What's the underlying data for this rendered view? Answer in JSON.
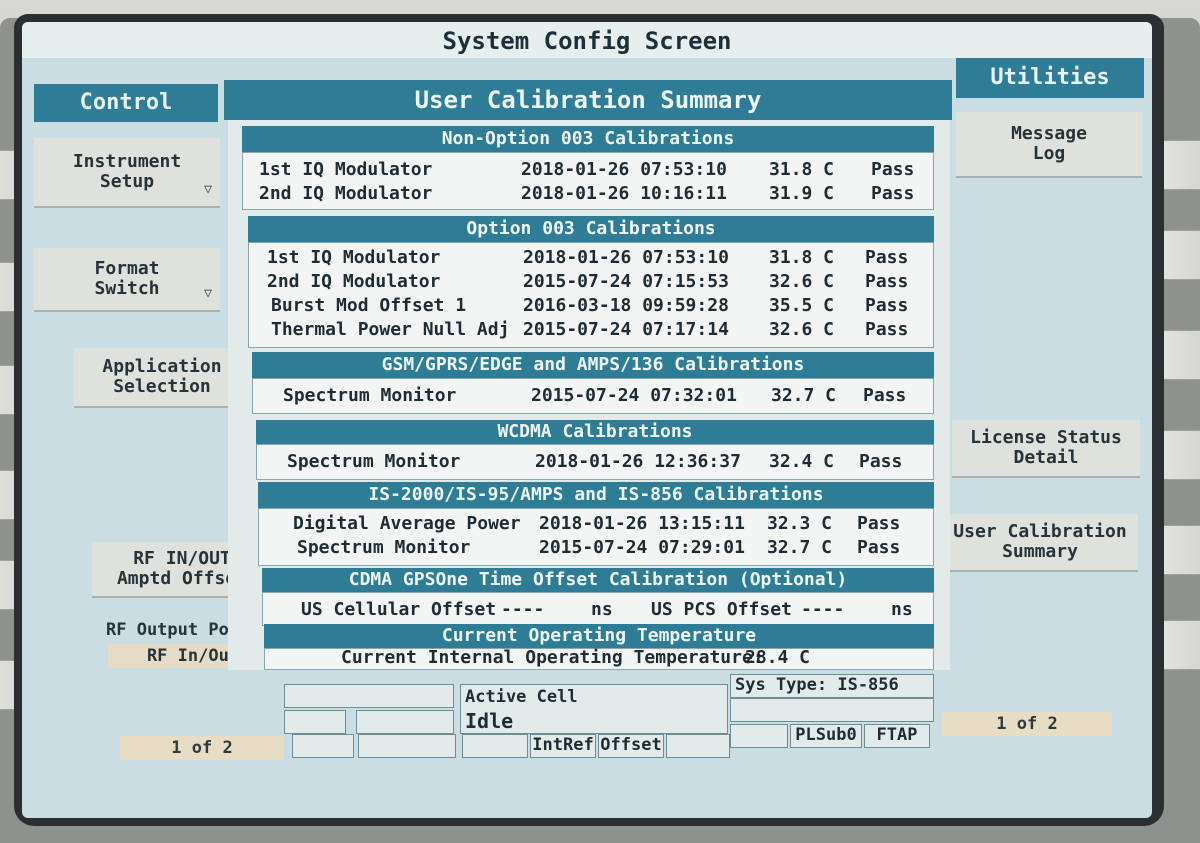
{
  "screen_title": "System Config Screen",
  "left_panel": {
    "title": "Control",
    "softkeys": [
      {
        "label_line1": "Instrument",
        "label_line2": "Setup",
        "has_arrow": true
      },
      {
        "label_line1": "Format",
        "label_line2": "Switch",
        "has_arrow": true
      },
      {
        "label_line1": "Application",
        "label_line2": "Selection",
        "has_arrow": false
      },
      {
        "label_line1": "RF IN/OUT",
        "label_line2": "Amptd Offset",
        "has_arrow": false
      }
    ],
    "rf_output_port_label": "RF Output Port",
    "rf_output_port_value": "RF In/Out",
    "page": "1 of 2"
  },
  "right_panel": {
    "title": "Utilities",
    "softkeys": [
      {
        "label_line1": "Message",
        "label_line2": "Log"
      },
      {
        "label_line1": "License Status",
        "label_line2": "Detail"
      },
      {
        "label_line1": "User Calibration",
        "label_line2": "Summary"
      }
    ],
    "page": "1 of 2"
  },
  "summary": {
    "title": "User Calibration Summary",
    "sections": [
      {
        "title": "Non-Option 003 Calibrations",
        "rows": [
          {
            "name": "1st IQ Modulator",
            "datetime": "2018-01-26 07:53:10",
            "temp": "31.8 C",
            "result": "Pass"
          },
          {
            "name": "2nd IQ Modulator",
            "datetime": "2018-01-26 10:16:11",
            "temp": "31.9 C",
            "result": "Pass"
          }
        ]
      },
      {
        "title": "Option 003 Calibrations",
        "rows": [
          {
            "name": "1st IQ Modulator",
            "datetime": "2018-01-26 07:53:10",
            "temp": "31.8 C",
            "result": "Pass"
          },
          {
            "name": "2nd IQ Modulator",
            "datetime": "2015-07-24 07:15:53",
            "temp": "32.6 C",
            "result": "Pass"
          },
          {
            "name": "Burst Mod Offset 1",
            "datetime": "2016-03-18 09:59:28",
            "temp": "35.5 C",
            "result": "Pass"
          },
          {
            "name": "Thermal Power Null Adj",
            "datetime": "2015-07-24 07:17:14",
            "temp": "32.6 C",
            "result": "Pass"
          }
        ]
      },
      {
        "title": "GSM/GPRS/EDGE and AMPS/136 Calibrations",
        "rows": [
          {
            "name": "Spectrum Monitor",
            "datetime": "2015-07-24 07:32:01",
            "temp": "32.7 C",
            "result": "Pass"
          }
        ]
      },
      {
        "title": "WCDMA Calibrations",
        "rows": [
          {
            "name": "Spectrum Monitor",
            "datetime": "2018-01-26 12:36:37",
            "temp": "32.4 C",
            "result": "Pass"
          }
        ]
      },
      {
        "title": "IS-2000/IS-95/AMPS and IS-856 Calibrations",
        "rows": [
          {
            "name": "Digital Average Power",
            "datetime": "2018-01-26 13:15:11",
            "temp": "32.3 C",
            "result": "Pass"
          },
          {
            "name": "Spectrum Monitor",
            "datetime": "2015-07-24 07:29:01",
            "temp": "32.7 C",
            "result": "Pass"
          }
        ]
      }
    ],
    "cdma_offset": {
      "title": "CDMA GPSOne Time Offset Calibration (Optional)",
      "us_cellular_label": "US Cellular Offset",
      "us_cellular_value": "----",
      "us_cellular_unit": "ns",
      "us_pcs_label": "US PCS Offset",
      "us_pcs_value": "----",
      "us_pcs_unit": "ns"
    },
    "operating_temp": {
      "title": "Current Operating Temperature",
      "label": "Current Internal Operating Temperature:",
      "value": "28.4 C"
    }
  },
  "status_bar": {
    "active_cell_label": "Active Cell",
    "active_cell_value": "Idle",
    "sys_type": "Sys Type: IS-856",
    "intref": "IntRef",
    "offset": "Offset",
    "plsub0": "PLSub0",
    "ftap": "FTAP"
  }
}
